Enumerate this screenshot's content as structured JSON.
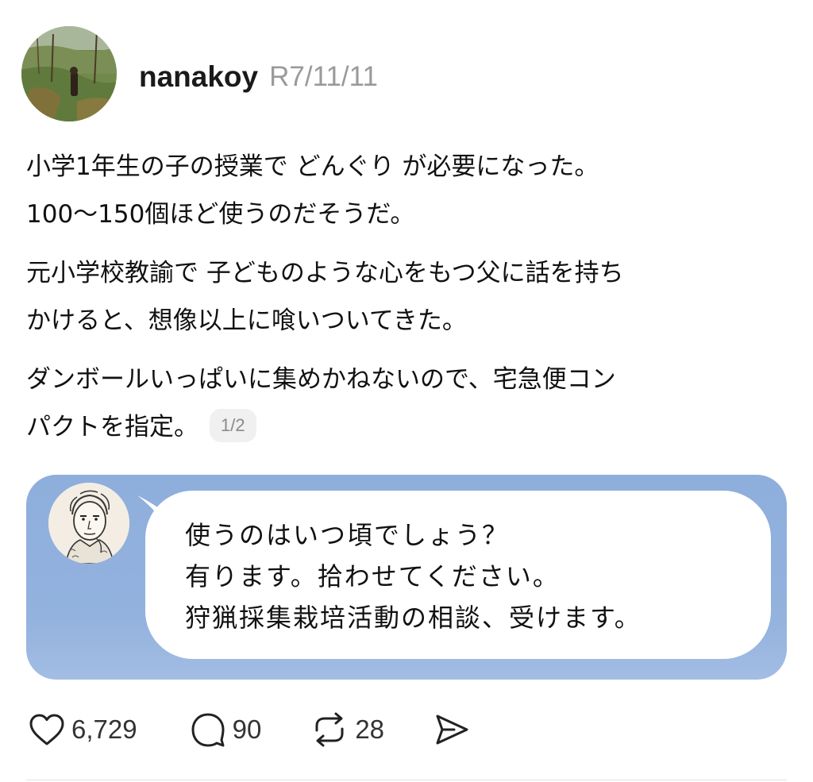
{
  "post": {
    "username": "nanakoy",
    "date": "R7/11/11",
    "paragraphs": [
      {
        "lines": [
          "小学1年生の子の授業で どんぐり が必要になった。",
          "100～150個ほど使うのだそうだ。"
        ]
      },
      {
        "lines": [
          "元小学校教諭で 子どものような心をもつ父に話を持ち",
          "かけると、想像以上に喰いついてきた。"
        ]
      },
      {
        "lines": [
          "ダンボールいっぱいに集めかねないので、宅急便コン",
          "パクトを指定。"
        ]
      }
    ],
    "page_indicator": "1/2"
  },
  "image_card": {
    "bubble_lines": [
      "使うのはいつ頃でしょう？",
      "有ります。拾わせてください。",
      "狩猟採集栽培活動の相談、受けます。"
    ],
    "background_color": "#8eaedc"
  },
  "actions": {
    "likes": "6,729",
    "replies": "90",
    "reposts": "28",
    "icons": [
      "heart-icon",
      "comment-icon",
      "repost-icon",
      "share-icon"
    ]
  }
}
